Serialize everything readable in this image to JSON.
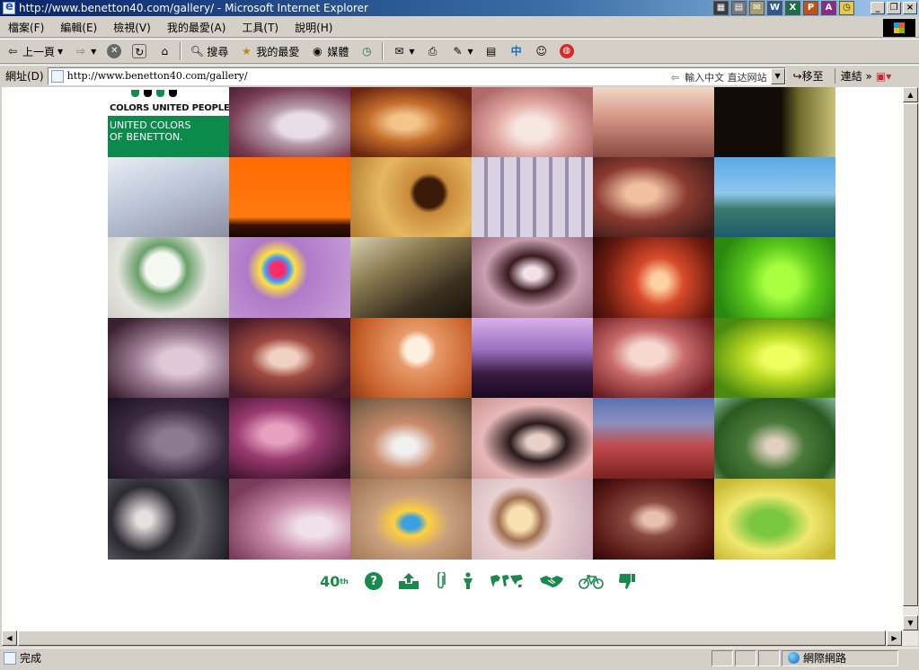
{
  "window": {
    "title": "http://www.benetton40.com/gallery/ - Microsoft Internet Explorer",
    "controls": {
      "minimize": "_",
      "restore": "❐",
      "close": "×"
    }
  },
  "tray_icons": [
    "W",
    "X",
    "P",
    "A",
    "◷"
  ],
  "menu": [
    "檔案(F)",
    "編輯(E)",
    "檢視(V)",
    "我的最愛(A)",
    "工具(T)",
    "說明(H)"
  ],
  "toolbar": {
    "back": "上一頁",
    "search": "搜尋",
    "favorites": "我的最愛",
    "media": "媒體",
    "zhong": "中"
  },
  "address": {
    "label": "網址(D)",
    "url": "http://www.benetton40.com/gallery/",
    "hint": "輸入中文 直达网站",
    "go": "移至",
    "links": "連結"
  },
  "logo": {
    "tagline": "COLORS UNITED PEOPLE",
    "brand_line1": "UNITED COLORS",
    "brand_line2": "OF BENETTON.",
    "brand_color": "#0b8a4b"
  },
  "footer_icons": {
    "forty": "40",
    "forty_sup": "th",
    "question": "?"
  },
  "status": {
    "text": "完成",
    "zone": "網際網路"
  },
  "colors": {
    "title_gradient_start": "#0a246a",
    "accent_green": "#1a8a4c",
    "chrome": "#d4d0c8"
  }
}
